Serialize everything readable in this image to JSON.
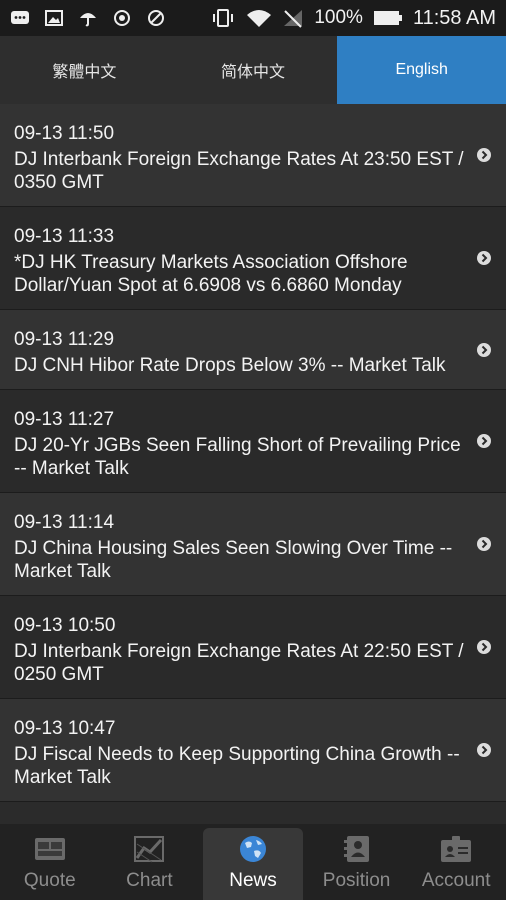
{
  "status_bar": {
    "battery_percent": "100%",
    "time": "11:58 AM"
  },
  "tabs": [
    {
      "label": "繁體中文",
      "active": false
    },
    {
      "label": "简体中文",
      "active": false
    },
    {
      "label": "English",
      "active": true
    }
  ],
  "news": [
    {
      "time": "09-13 11:50",
      "headline": "DJ Interbank Foreign Exchange Rates At 23:50 EST / 0350 GMT"
    },
    {
      "time": "09-13 11:33",
      "headline": "*DJ HK Treasury Markets Association Offshore Dollar/Yuan Spot at 6.6908 vs 6.6860 Monday"
    },
    {
      "time": "09-13 11:29",
      "headline": "DJ CNH Hibor Rate Drops Below 3% -- Market Talk"
    },
    {
      "time": "09-13 11:27",
      "headline": "DJ 20-Yr JGBs Seen Falling Short of Prevailing Price -- Market Talk"
    },
    {
      "time": "09-13 11:14",
      "headline": "DJ China Housing Sales Seen Slowing Over Time -- Market Talk"
    },
    {
      "time": "09-13 10:50",
      "headline": "DJ Interbank Foreign Exchange Rates At 22:50 EST / 0250 GMT"
    },
    {
      "time": "09-13 10:47",
      "headline": "DJ Fiscal Needs to Keep Supporting China Growth -- Market Talk"
    }
  ],
  "bottom_nav": [
    {
      "label": "Quote",
      "icon": "quote-icon",
      "active": false
    },
    {
      "label": "Chart",
      "icon": "chart-icon",
      "active": false
    },
    {
      "label": "News",
      "icon": "globe-icon",
      "active": true
    },
    {
      "label": "Position",
      "icon": "position-icon",
      "active": false
    },
    {
      "label": "Account",
      "icon": "account-icon",
      "active": false
    }
  ],
  "colors": {
    "accent": "#2f7fc3",
    "background": "#2b2b2b"
  }
}
